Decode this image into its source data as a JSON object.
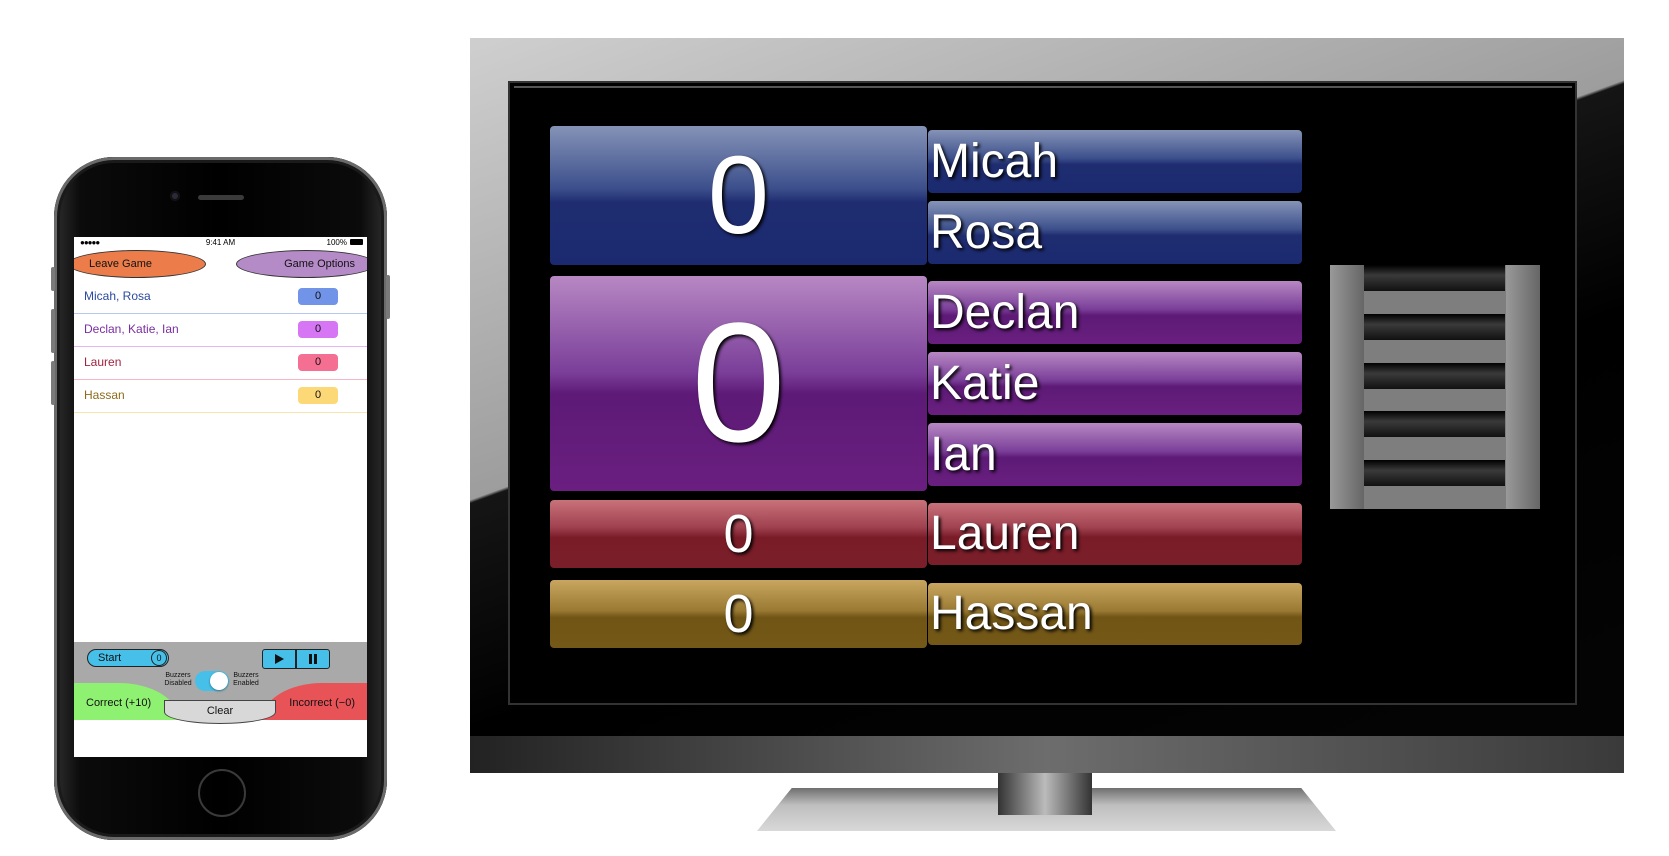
{
  "phone": {
    "status": {
      "signal": "●●●●● ",
      "time": "9:41 AM",
      "battery": "100%"
    },
    "leave_game": "Leave Game",
    "game_options": "Game Options",
    "teams": [
      {
        "name": "Micah, Rosa",
        "score": "0",
        "color": "#2b4a9e",
        "badge": "#7193e8",
        "line": "#b8c6f2"
      },
      {
        "name": "Declan, Katie, Ian",
        "score": "0",
        "color": "#7a2ea0",
        "badge": "#d776f5",
        "line": "#e7b5f5"
      },
      {
        "name": "Lauren",
        "score": "0",
        "color": "#a02442",
        "badge": "#f56f93",
        "line": "#f7b5c6"
      },
      {
        "name": "Hassan",
        "score": "0",
        "color": "#8e6b1a",
        "badge": "#fcd877",
        "line": "#f6e4b1"
      }
    ],
    "controls": {
      "start": "Start",
      "start_count": "0",
      "buzzers_disabled": "Buzzers Disabled",
      "buzzers_enabled": "Buzzers Enabled",
      "correct": "Correct (+10)",
      "incorrect": "Incorrect (−0)",
      "clear": "Clear"
    }
  },
  "tv": {
    "teams": [
      {
        "score": "0",
        "members": [
          "Micah",
          "Rosa"
        ]
      },
      {
        "score": "0",
        "members": [
          "Declan",
          "Katie",
          "Ian"
        ]
      },
      {
        "score": "0",
        "members": [
          "Lauren"
        ]
      },
      {
        "score": "0",
        "members": [
          "Hassan"
        ]
      }
    ]
  }
}
